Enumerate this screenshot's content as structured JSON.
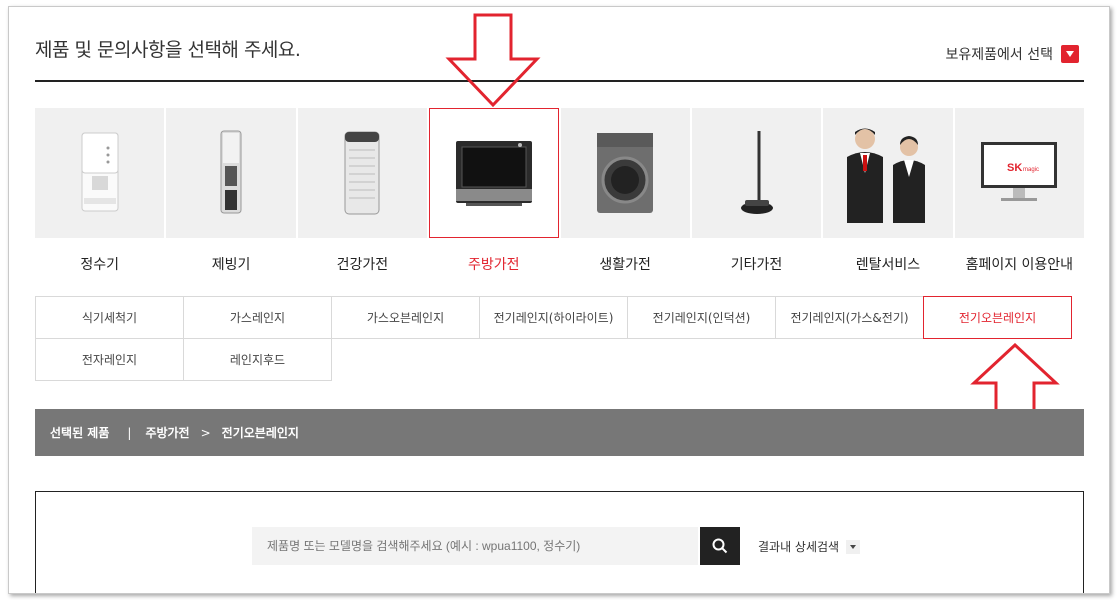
{
  "header": {
    "title": "제품 및 문의사항을 선택해 주세요.",
    "owned_label": "보유제품에서 선택"
  },
  "categories": [
    {
      "label": "정수기",
      "icon": "water-purifier-icon"
    },
    {
      "label": "제빙기",
      "icon": "ice-maker-icon"
    },
    {
      "label": "건강가전",
      "icon": "air-purifier-icon"
    },
    {
      "label": "주방가전",
      "icon": "oven-icon",
      "active": true
    },
    {
      "label": "생활가전",
      "icon": "washing-machine-icon"
    },
    {
      "label": "기타가전",
      "icon": "mop-icon"
    },
    {
      "label": "렌탈서비스",
      "icon": "staff-icon"
    },
    {
      "label": "홈페이지 이용안내",
      "icon": "monitor-icon"
    }
  ],
  "subcategories": {
    "row1": [
      "식기세척기",
      "가스레인지",
      "가스오븐레인지",
      "전기레인지(하이라이트)",
      "전기레인지(인덕션)",
      "전기레인지(가스&전기)",
      "전기오븐레인지"
    ],
    "row2": [
      "전자레인지",
      "레인지후드"
    ]
  },
  "selected_bar": {
    "label": "선택된 제품",
    "divider": "|",
    "category": "주방가전",
    "chevron": ">",
    "product": "전기오븐레인지"
  },
  "search": {
    "placeholder": "제품명 또는 모델명을 검색해주세요 (예시 : wpua1100, 정수기)",
    "advanced_label": "결과내 상세검색"
  },
  "monitor_logo": {
    "brand": "SK",
    "sub": "magic"
  },
  "colors": {
    "accent": "#e2242f",
    "bar": "#777777"
  }
}
